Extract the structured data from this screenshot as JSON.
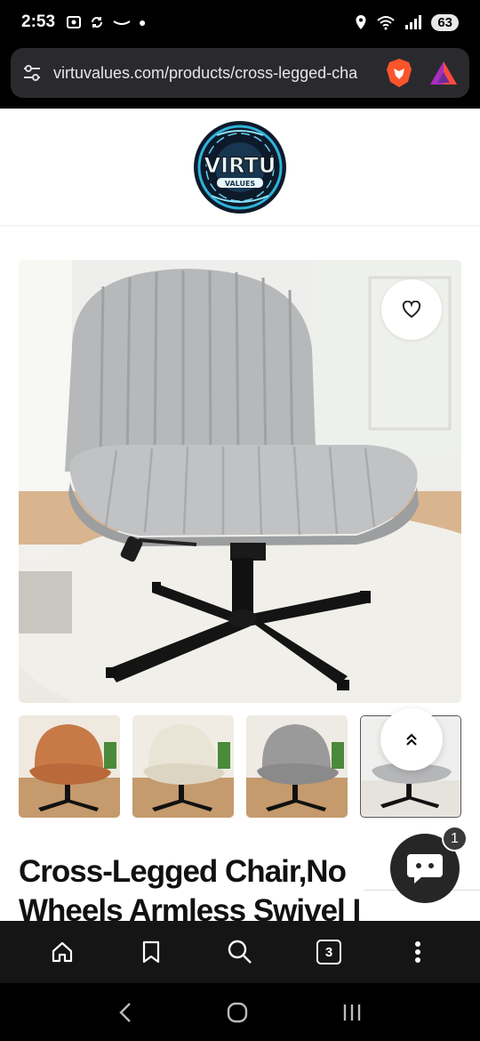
{
  "status_bar": {
    "time": "2:53",
    "battery": "63"
  },
  "browser": {
    "url": "virtuvalues.com/products/cross-legged-cha",
    "tabs_count": "3"
  },
  "site": {
    "logo_text": "VIRTU",
    "logo_subtext": "VALUES"
  },
  "product": {
    "title": "Cross-Legged Chair,No Wheels Armless Swivel I",
    "thumbnails": [
      {
        "color_name": "orange",
        "color": "#c77a46"
      },
      {
        "color_name": "cream",
        "color": "#eae4d6"
      },
      {
        "color_name": "gray-fabric",
        "color": "#9a9a9a"
      },
      {
        "color_name": "gray-leather",
        "color": "#b5b6b8"
      }
    ]
  },
  "chat": {
    "badge_count": "1"
  }
}
